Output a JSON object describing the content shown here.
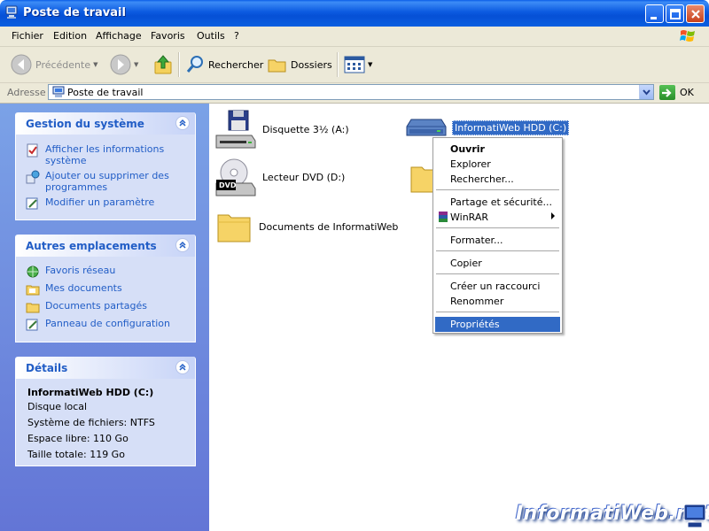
{
  "window": {
    "title": "Poste de travail"
  },
  "menu": [
    "Fichier",
    "Edition",
    "Affichage",
    "Favoris",
    "Outils",
    "?"
  ],
  "toolbar": {
    "back_label": "Précédente",
    "search_label": "Rechercher",
    "folders_label": "Dossiers"
  },
  "address": {
    "label": "Adresse",
    "value": "Poste de travail",
    "go_label": "OK"
  },
  "left": {
    "system": {
      "title": "Gestion du système",
      "items": [
        "Afficher les informations système",
        "Ajouter ou supprimer des programmes",
        "Modifier un paramètre"
      ]
    },
    "places": {
      "title": "Autres emplacements",
      "items": [
        "Favoris réseau",
        "Mes documents",
        "Documents partagés",
        "Panneau de configuration"
      ]
    },
    "details": {
      "title": "Détails",
      "name": "InformatiWeb HDD (C:)",
      "type": "Disque local",
      "fs": "Système de fichiers: NTFS",
      "free": "Espace libre: 110 Go",
      "total": "Taille totale: 119 Go"
    }
  },
  "drives": [
    {
      "label": "Disquette 3½ (A:)",
      "icon": "floppy-drive-icon"
    },
    {
      "label": "InformatiWeb HDD (C:)",
      "icon": "hard-drive-icon",
      "selected": true
    },
    {
      "label": "Lecteur DVD (D:)",
      "icon": "dvd-drive-icon"
    },
    {
      "label": "Documents de InformatiWeb",
      "icon": "folder-icon"
    }
  ],
  "context_menu": {
    "open": "Ouvrir",
    "explore": "Explorer",
    "search": "Rechercher...",
    "sharing": "Partage et sécurité...",
    "winrar": "WinRAR",
    "format": "Formater...",
    "copy": "Copier",
    "shortcut": "Créer un raccourci",
    "rename": "Renommer",
    "properties": "Propriétés"
  },
  "watermark": "InformatiWeb.net",
  "colors": {
    "titlebar": "#0a5fe8",
    "taskpane": "#7ba2e7",
    "link": "#215dc6",
    "highlight": "#316ac5"
  }
}
